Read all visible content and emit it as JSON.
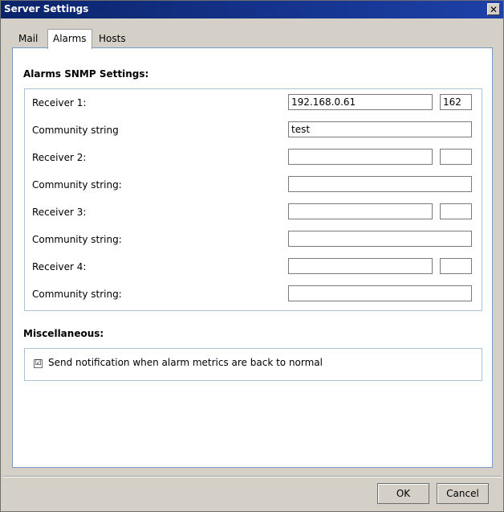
{
  "window": {
    "title": "Server Settings",
    "close_glyph": "✕"
  },
  "tabs": [
    {
      "label": "Mail",
      "active": false
    },
    {
      "label": "Alarms",
      "active": true
    },
    {
      "label": "Hosts",
      "active": false
    }
  ],
  "snmp": {
    "title": "Alarms SNMP Settings:",
    "rows": [
      {
        "label": "Receiver 1:",
        "address": "192.168.0.61",
        "port": "162"
      },
      {
        "label": "Community string",
        "value": "test"
      },
      {
        "label": "Receiver 2:",
        "address": "",
        "port": ""
      },
      {
        "label": "Community string:",
        "value": ""
      },
      {
        "label": "Receiver 3:",
        "address": "",
        "port": ""
      },
      {
        "label": "Community string:",
        "value": ""
      },
      {
        "label": "Receiver 4:",
        "address": "",
        "port": ""
      },
      {
        "label": "Community string:",
        "value": ""
      }
    ]
  },
  "misc": {
    "title": "Miscellaneous:",
    "notify_label": "Send notification when alarm metrics are back to normal",
    "notify_checked": true,
    "check_glyph": "☑"
  },
  "buttons": {
    "ok": "OK",
    "cancel": "Cancel"
  }
}
